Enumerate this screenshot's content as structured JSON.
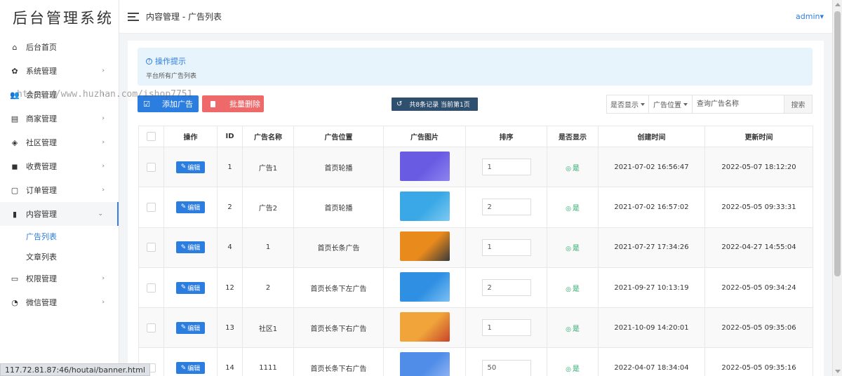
{
  "app": {
    "logo": "后台管理系统"
  },
  "sidebar": {
    "items": [
      {
        "label": "后台首页",
        "icon": "home-icon",
        "glyph": "⌂",
        "arrow": ""
      },
      {
        "label": "系统管理",
        "icon": "gear-icon",
        "glyph": "✿",
        "arrow": "›"
      },
      {
        "label": "会员管理",
        "icon": "users-icon",
        "glyph": "👥",
        "arrow": "›"
      },
      {
        "label": "商家管理",
        "icon": "store-icon",
        "glyph": "▤",
        "arrow": "›"
      },
      {
        "label": "社区管理",
        "icon": "dropbox-icon",
        "glyph": "◈",
        "arrow": "›"
      },
      {
        "label": "收费管理",
        "icon": "bag-icon",
        "glyph": "◼",
        "arrow": "›"
      },
      {
        "label": "订单管理",
        "icon": "clipboard-icon",
        "glyph": "▢",
        "arrow": "›"
      },
      {
        "label": "内容管理",
        "icon": "file-icon",
        "glyph": "▮",
        "arrow": "⌄"
      }
    ],
    "submenu": [
      {
        "label": "广告列表"
      },
      {
        "label": "文章列表"
      }
    ],
    "items_after": [
      {
        "label": "权限管理",
        "icon": "monitor-icon",
        "glyph": "▭",
        "arrow": "›"
      },
      {
        "label": "微信管理",
        "icon": "wechat-icon",
        "glyph": "◔",
        "arrow": "›"
      }
    ]
  },
  "header": {
    "breadcrumb": "内容管理 - 广告列表",
    "user": "admin▾"
  },
  "tips": {
    "title": "操作提示",
    "text": "平台所有广告列表"
  },
  "toolbar": {
    "add_label": "添加广告",
    "delete_label": "批量删除",
    "record_text": "共8条记录 当前第1页"
  },
  "filter": {
    "show_select": "是否显示",
    "position_select": "广告位置",
    "search_placeholder": "查询广告名称",
    "search_button": "搜索"
  },
  "table": {
    "columns": [
      "操作",
      "ID",
      "广告名称",
      "广告位置",
      "广告图片",
      "排序",
      "是否显示",
      "创建时间",
      "更新时间"
    ],
    "edit_label": "编辑",
    "rows": [
      {
        "id": "1",
        "name": "广告1",
        "position": "首页轮播",
        "sort": "1",
        "show": "是",
        "created": "2021-07-02 16:56:47",
        "updated": "2022-05-07 18:12:20",
        "img_color": "#6a5be3",
        "img_color2": "#8e84f0"
      },
      {
        "id": "2",
        "name": "广告2",
        "position": "首页轮播",
        "sort": "2",
        "show": "是",
        "created": "2021-07-02 16:57:02",
        "updated": "2022-05-05 09:33:31",
        "img_color": "#3aa8e6",
        "img_color2": "#7dcaf2"
      },
      {
        "id": "4",
        "name": "1",
        "position": "首页长条广告",
        "sort": "1",
        "show": "是",
        "created": "2021-07-27 17:34:26",
        "updated": "2022-04-27 14:55:04",
        "img_color": "#e98a1c",
        "img_color2": "#3a3a3a"
      },
      {
        "id": "12",
        "name": "2",
        "position": "首页长条下左广告",
        "sort": "2",
        "show": "是",
        "created": "2021-09-27 10:13:19",
        "updated": "2022-05-05 09:34:24",
        "img_color": "#2f8fe3",
        "img_color2": "#7bc0f3"
      },
      {
        "id": "13",
        "name": "社区1",
        "position": "首页长条下右广告",
        "sort": "1",
        "show": "是",
        "created": "2021-10-09 14:20:01",
        "updated": "2022-05-05 09:35:06",
        "img_color": "#f0a43a",
        "img_color2": "#c8442b"
      },
      {
        "id": "14",
        "name": "1111",
        "position": "首页长条下右广告",
        "sort": "50",
        "show": "是",
        "created": "2022-04-07 18:34:04",
        "updated": "2022-05-05 09:35:16",
        "img_color": "#4f8de8",
        "img_color2": "#9ab8f5"
      }
    ]
  },
  "statusbar": {
    "url": "117.72.81.87:46/houtai/banner.html"
  },
  "watermark": {
    "text": "https://www.huzhan.com/ishop7751"
  },
  "colors": {
    "primary": "#2b7de0",
    "danger": "#ee6a6a",
    "success": "#27a86a",
    "tips_bg": "#e8f4fb"
  }
}
